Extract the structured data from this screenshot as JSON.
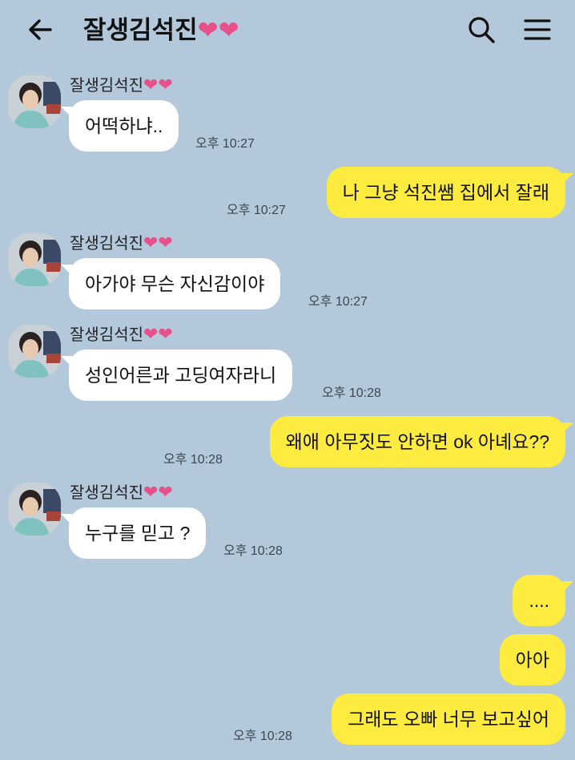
{
  "header": {
    "title": "잘생김석진",
    "title_hearts": "❤❤",
    "back_icon": "arrow-left-icon",
    "search_icon": "search-icon",
    "menu_icon": "hamburger-menu-icon"
  },
  "colors": {
    "background": "#b3c8da",
    "incoming_bubble": "#ffffff",
    "outgoing_bubble": "#fdeb3f",
    "heart": "#e8508a"
  },
  "messages": [
    {
      "direction": "in",
      "sender": "잘생김석진",
      "sender_hearts": "❤❤",
      "text": "어떡하냐..",
      "time": "오후 10:27"
    },
    {
      "direction": "out",
      "text": "나 그냥 석진쌤 집에서 잘래",
      "time": "오후 10:27"
    },
    {
      "direction": "in",
      "sender": "잘생김석진",
      "sender_hearts": "❤❤",
      "text": "아가야 무슨 자신감이야",
      "time": "오후 10:27"
    },
    {
      "direction": "in",
      "sender": "잘생김석진",
      "sender_hearts": "❤❤",
      "text": "성인어른과 고딩여자라니",
      "time": "오후 10:28"
    },
    {
      "direction": "out",
      "text": "왜애 아무짓도 안하면 ok 아녜요??",
      "time": "오후 10:28"
    },
    {
      "direction": "in",
      "sender": "잘생김석진",
      "sender_hearts": "❤❤",
      "text": "누구를 믿고 ?",
      "time": "오후 10:28"
    },
    {
      "direction": "out",
      "text": "....",
      "time": ""
    },
    {
      "direction": "out",
      "text": "아아",
      "time": ""
    },
    {
      "direction": "out",
      "text": "그래도 오빠 너무 보고싶어",
      "time": "오후 10:28"
    }
  ]
}
